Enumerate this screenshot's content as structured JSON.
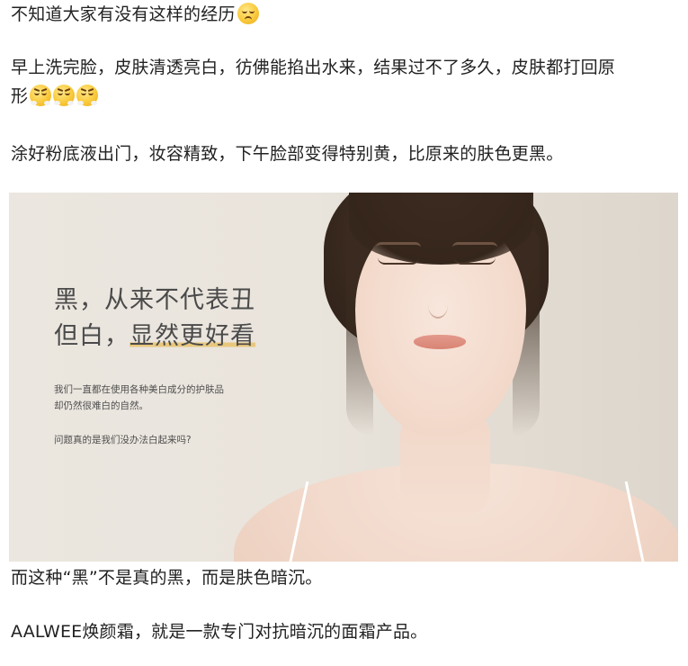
{
  "paragraphs": {
    "p1": "不知道大家有没有这样的经历",
    "p2_line1": "早上洗完脸，皮肤清透亮白，彷佛能掐出水来，结果过不了多久，皮肤都打回原",
    "p2_line2": "形",
    "p3": "涂好粉底液出门，妆容精致，下午脸部变得特别黄，比原来的肤色更黑。",
    "p4": "而这种“黑”不是真的黑，而是肤色暗沉。",
    "p5": "AALWEE焕颜霜，就是一款专门对抗暗沉的面霜产品。"
  },
  "emojis": {
    "p1_end": "pensive-face-icon",
    "p2_end": [
      "steam-face-icon",
      "steam-face-icon",
      "steam-face-icon"
    ]
  },
  "hero": {
    "headline_line1": "黑，从来不代表丑",
    "headline_line2_prefix": "但白，",
    "headline_line2_highlight": "显然更好看",
    "sub_line1": "我们一直都在使用各种美白成分的护肤品",
    "sub_line2": "却仍然很难白的自然。",
    "question": "问题真的是我们没办法白起来吗?",
    "highlight_color": "#e8c77d",
    "background_color": "#e9e4dc"
  }
}
